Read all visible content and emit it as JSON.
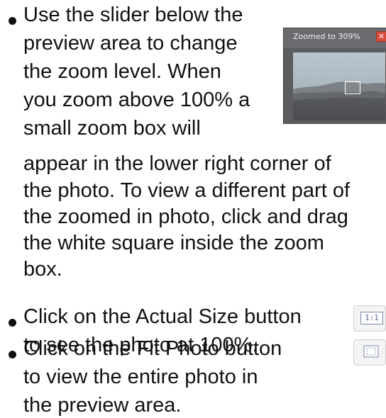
{
  "instructions": {
    "item1": {
      "lines": [
        "Use the slider below the",
        "preview area to change",
        "the zoom level. When",
        "you zoom above 100% a",
        "small zoom box will",
        "appear in the lower right corner of",
        "the photo. To view a different part of",
        "the zoomed in photo, click and drag",
        "the white square inside the zoom",
        "box."
      ]
    },
    "item2": {
      "lines": [
        "Click on the Actual Size button",
        "to see the photo at 100%."
      ]
    },
    "item3": {
      "lines": [
        "Click on the Fit Photo button",
        "to view the entire photo in",
        "the preview area."
      ]
    }
  },
  "preview": {
    "title": "Zoomed to 309%",
    "close_icon": "close-icon",
    "zoom_box_icon": "zoom-box"
  },
  "buttons": {
    "actual_size_label": "1:1",
    "fit_photo_icon": "fit-photo-icon"
  },
  "colors": {
    "preview_bg": "#5a5c5f",
    "close_red": "#d74b3a",
    "zoom_box_border": "#ffffff"
  }
}
